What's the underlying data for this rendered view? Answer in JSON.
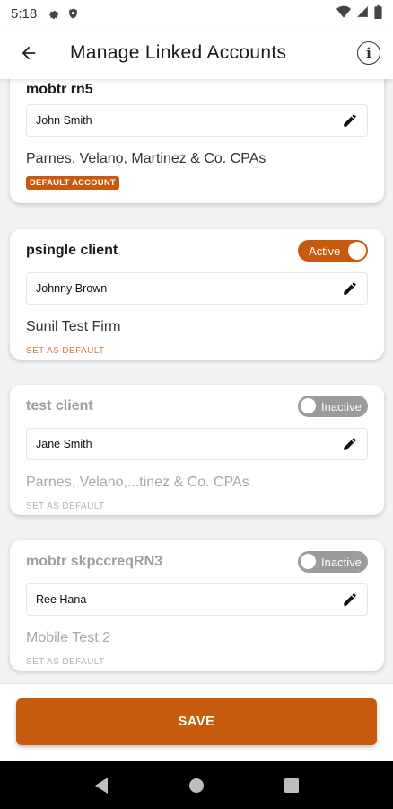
{
  "status_bar": {
    "time": "5:18",
    "icons": [
      "gear-icon",
      "shield-icon",
      "wifi-icon",
      "signal-icon",
      "battery-icon"
    ]
  },
  "header": {
    "title": "Manage Linked Accounts",
    "info_label": "i"
  },
  "accounts": [
    {
      "client_name": "mobtr rn5",
      "contact": "John Smith",
      "firm": "Parnes, Velano, Martinez & Co. CPAs",
      "default_label": "DEFAULT ACCOUNT",
      "is_default": true
    },
    {
      "client_name": "psingle client",
      "contact": "Johnny Brown",
      "firm": "Sunil Test Firm",
      "toggle_label": "Active",
      "status": "active",
      "set_default_label": "SET AS DEFAULT"
    },
    {
      "client_name": "test client",
      "contact": "Jane Smith",
      "firm": "Parnes, Velano,...tinez & Co. CPAs",
      "toggle_label": "Inactive",
      "status": "inactive",
      "set_default_label": "SET AS DEFAULT"
    },
    {
      "client_name": "mobtr skpccreqRN3",
      "contact": "Ree Hana",
      "firm": "Mobile Test 2",
      "toggle_label": "Inactive",
      "status": "inactive",
      "set_default_label": "SET AS DEFAULT"
    }
  ],
  "save_label": "SAVE",
  "colors": {
    "accent": "#c75a0c",
    "inactive": "#9b9b9b",
    "background": "#f2f2f2"
  }
}
